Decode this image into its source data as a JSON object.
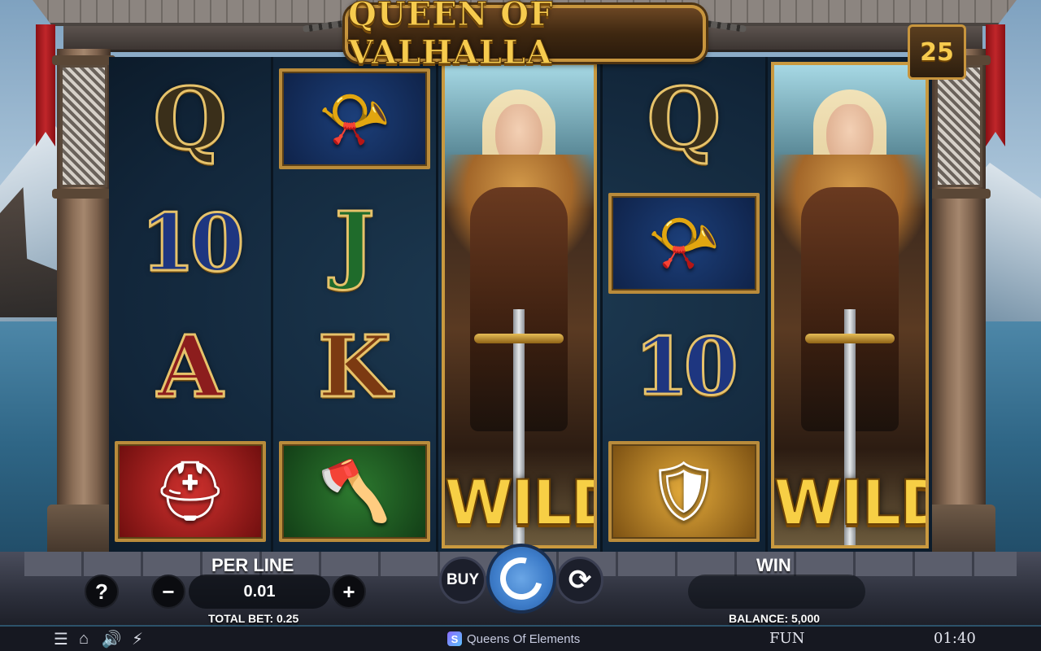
{
  "game": {
    "title": "QUEEN OF VALHALLA",
    "lines": "25"
  },
  "reels": {
    "col1": [
      {
        "type": "letter",
        "text": "Q",
        "style": "q"
      },
      {
        "type": "letter",
        "text": "10",
        "style": "ten"
      },
      {
        "type": "letter",
        "text": "A",
        "style": "ace"
      },
      {
        "type": "tile",
        "icon": "viking-helmet-icon",
        "glyph": "⛑",
        "style": "helmet"
      }
    ],
    "col2": [
      {
        "type": "tile",
        "icon": "drinking-horn-icon",
        "glyph": "📯",
        "style": "horn"
      },
      {
        "type": "letter",
        "text": "J",
        "style": "jack"
      },
      {
        "type": "letter",
        "text": "K",
        "style": "king"
      },
      {
        "type": "tile",
        "icon": "axe-icon",
        "glyph": "🪓",
        "style": "axe"
      }
    ],
    "col3": {
      "wild_label": "WILD"
    },
    "col4": [
      {
        "type": "letter",
        "text": "Q",
        "style": "q"
      },
      {
        "type": "tile",
        "icon": "drinking-horn-icon",
        "glyph": "📯",
        "style": "horn"
      },
      {
        "type": "letter",
        "text": "10",
        "style": "ten"
      },
      {
        "type": "tile",
        "icon": "viking-shield-icon",
        "glyph": "🛡",
        "style": "shield"
      }
    ],
    "col5": {
      "wild_label": "WILD"
    }
  },
  "controls": {
    "per_line_label": "PER LINE",
    "bet_value": "0.01",
    "total_bet": "TOTAL BET: 0.25",
    "win_label": "WIN",
    "win_value": "",
    "balance": "BALANCE: 5,000",
    "help_label": "?",
    "minus_label": "−",
    "plus_label": "+",
    "buy_label": "BUY",
    "autoplay_glyph": "⟳"
  },
  "footer": {
    "menu_glyph": "☰",
    "home_glyph": "⌂",
    "sound_glyph": "🔊",
    "turbo_glyph": "⚡",
    "brand_logo": "S",
    "brand_name": "Queens Of Elements",
    "mode": "FUN",
    "clock": "01:40"
  },
  "colors": {
    "gold": "#f6cb4e",
    "spin_blue": "#3d7cc9",
    "banner_red": "#c0262a"
  }
}
